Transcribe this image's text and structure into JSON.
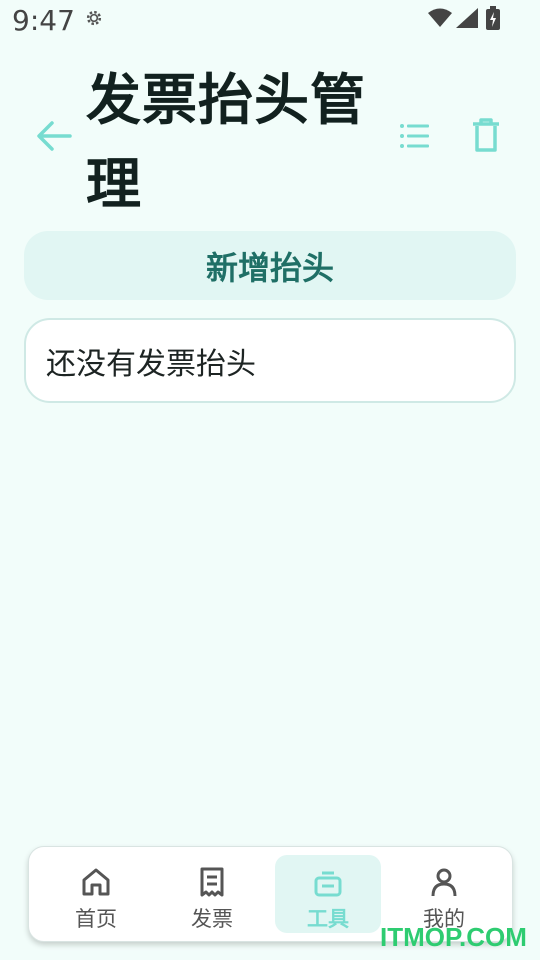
{
  "status_bar": {
    "time": "9:47",
    "icons": [
      "gear-icon",
      "wifi-icon",
      "signal-icon",
      "battery-icon"
    ]
  },
  "app_bar": {
    "title": "发票抬头管理",
    "actions": [
      "back-arrow-icon",
      "list-icon",
      "delete-icon"
    ]
  },
  "add_button": {
    "label": "新增抬头"
  },
  "empty_state": {
    "text": "还没有发票抬头"
  },
  "bottom_nav": {
    "items": [
      {
        "label": "首页",
        "icon": "home-icon",
        "active": false
      },
      {
        "label": "发票",
        "icon": "invoice-icon",
        "active": false
      },
      {
        "label": "工具",
        "icon": "toolbox-icon",
        "active": true
      },
      {
        "label": "我的",
        "icon": "person-icon",
        "active": false
      }
    ]
  },
  "watermark": "ITMOP.COM",
  "colors": {
    "background": "#f2fdfa",
    "accent": "#77dcd0",
    "button_bg": "#e1f6f3",
    "button_text": "#1f6f66"
  }
}
